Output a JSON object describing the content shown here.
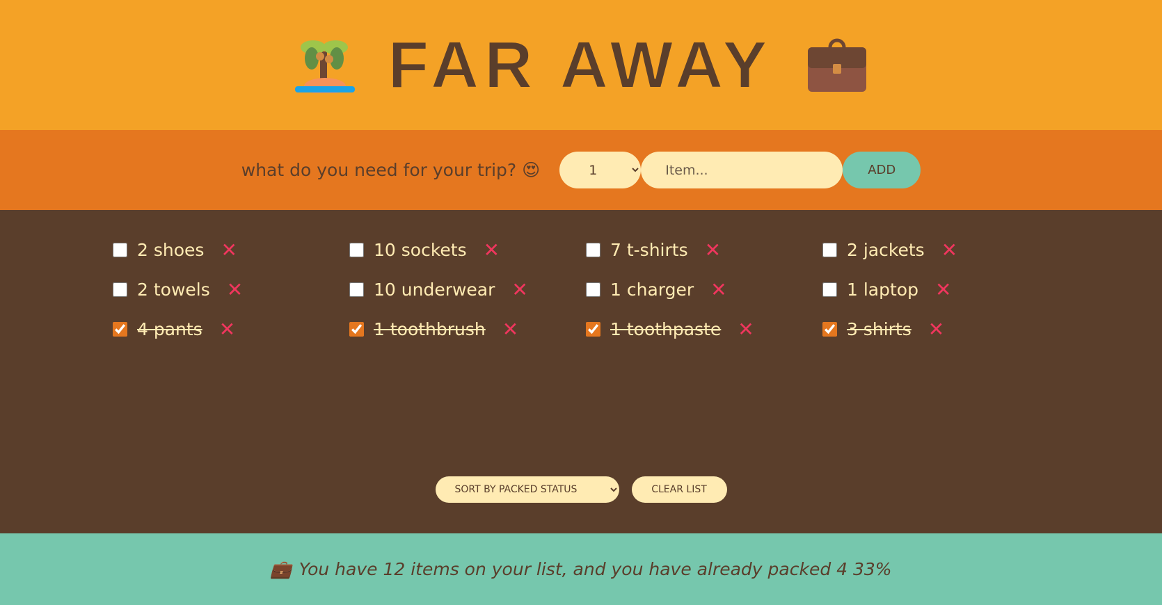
{
  "header": {
    "title": "FAR AWAY",
    "left_icon": "palm-island-emoji",
    "right_icon": "briefcase-emoji"
  },
  "form": {
    "question": "what do you need for your trip?",
    "question_icon": "heart-eyes-emoji",
    "quantity": "1",
    "item_placeholder": "Item...",
    "add_label": "ADD"
  },
  "items": [
    {
      "label": "2 shoes",
      "packed": false
    },
    {
      "label": "10 sockets",
      "packed": false
    },
    {
      "label": "7 t-shirts",
      "packed": false
    },
    {
      "label": "2 jackets",
      "packed": false
    },
    {
      "label": "2 towels",
      "packed": false
    },
    {
      "label": "10 underwear",
      "packed": false
    },
    {
      "label": "1 charger",
      "packed": false
    },
    {
      "label": "1 laptop",
      "packed": false
    },
    {
      "label": "4 pants",
      "packed": true
    },
    {
      "label": "1 toothbrush",
      "packed": true
    },
    {
      "label": "1 toothpaste",
      "packed": true
    },
    {
      "label": "3 shirts",
      "packed": true
    }
  ],
  "actions": {
    "sort_value": "SORT BY PACKED STATUS",
    "clear_label": "CLEAR LIST"
  },
  "stats": {
    "icon": "briefcase-emoji",
    "text": "You have 12 items on your list, and you have already packed 4 33%"
  },
  "colors": {
    "header": "#f4a226",
    "form": "#e5771f",
    "list": "#5a3e2b",
    "stats": "#76c7ad",
    "delete": "#f0365e"
  }
}
